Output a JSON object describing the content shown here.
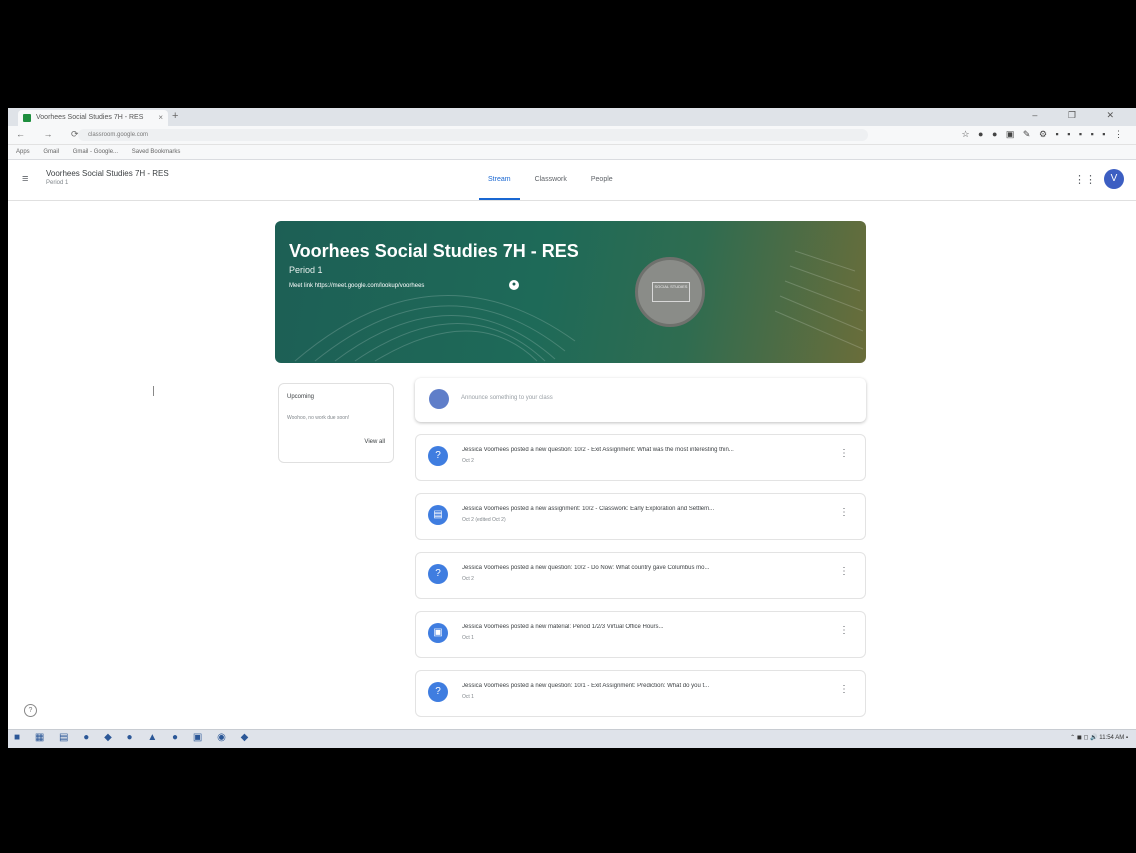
{
  "browser": {
    "tab_title": "Voorhees Social Studies 7H - RES",
    "tab_close": "×",
    "new_tab": "+",
    "window_controls": "– ❐ ✕",
    "nav_buttons": "← → ⟳",
    "url": "classroom.google.com",
    "extensions": "☆ ● ● ▣ ✎ ⚙ ▪ ▪ ▪ ▪ ▪ ⋮",
    "bookmarks": [
      "Apps",
      "Gmail",
      "Gmail - Google...",
      "Saved Bookmarks"
    ]
  },
  "header": {
    "class_title": "Voorhees Social Studies 7H - RES",
    "class_sub": "Period 1",
    "tabs": [
      {
        "label": "Stream",
        "active": true
      },
      {
        "label": "Classwork",
        "active": false
      },
      {
        "label": "People",
        "active": false
      }
    ],
    "avatar_initial": "V",
    "menu_icon": "≡",
    "apps_icon": "⋮⋮⋮"
  },
  "banner": {
    "title": "Voorhees Social Studies 7H - RES",
    "period": "Period 1",
    "meet_link": "Meet link  https://meet.google.com/lookup/voorhees",
    "badge_text": "SOCIAL STUDIES"
  },
  "upcoming": {
    "title": "Upcoming",
    "text": "Woohoo, no work due soon!",
    "view_all": "View all"
  },
  "announce": {
    "placeholder": "Announce something to your class"
  },
  "stream": [
    {
      "icon": "?",
      "text": "Jessica Voorhees posted a new question: 10/2 - Exit Assignment: What was the most interesting thin...",
      "date": "Oct 2"
    },
    {
      "icon": "▤",
      "text": "Jessica Voorhees posted a new assignment: 10/2 - Classwork: Early Exploration and Settlem...",
      "date": "Oct 2 (edited Oct 2)"
    },
    {
      "icon": "?",
      "text": "Jessica Voorhees posted a new question: 10/2 - Do Now: What country gave Columbus mo...",
      "date": "Oct 2"
    },
    {
      "icon": "▣",
      "text": "Jessica Voorhees posted a new material: Period 1/2/3 Virtual Office Hours...",
      "date": "Oct 1"
    },
    {
      "icon": "?",
      "text": "Jessica Voorhees posted a new question: 10/1 - Exit Assignment: Prediction: What do you t...",
      "date": "Oct 1"
    }
  ],
  "taskbar": {
    "icons": "■ ▦ ▤ ● ◆ ● ▲ ● ▣ ◉ ◆",
    "tray": "⌃ ◼ ◻ 🔊 11:54 AM ▪"
  },
  "colors": {
    "accent": "#1967d2",
    "banner_start": "#1d5f55",
    "banner_end": "#6a6d3a",
    "post_icon": "#3f7de0"
  }
}
